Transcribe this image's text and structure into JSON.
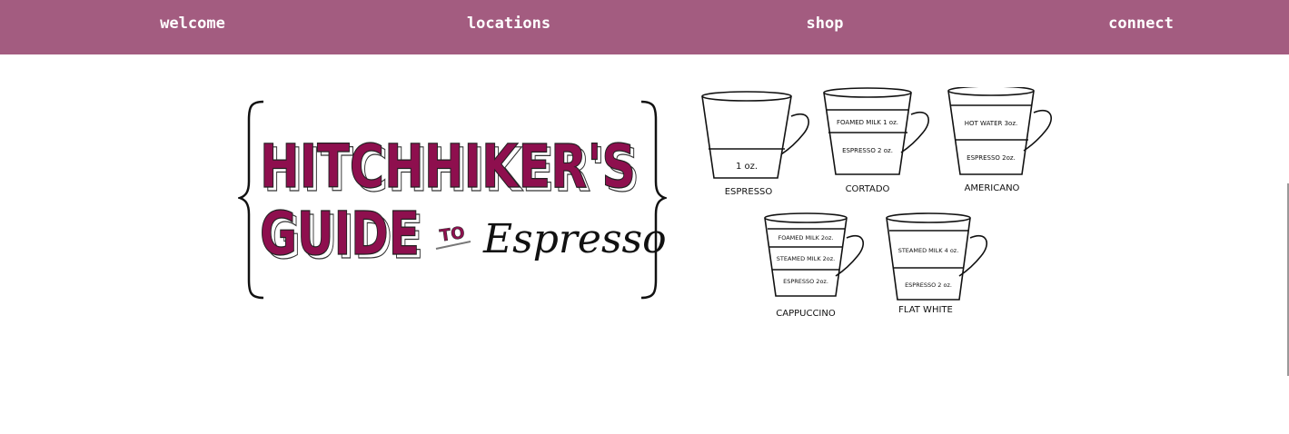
{
  "nav": {
    "items": [
      "welcome",
      "locations",
      "shop",
      "connect"
    ],
    "background": "#a35c80",
    "text_color": "#ffffff"
  },
  "logo": {
    "line1": "HITCHHIKER'S",
    "line2": "GUIDE",
    "to": "TO",
    "script": "Espresso",
    "fill_color": "#8e0f4e"
  },
  "cups": [
    {
      "name": "ESPRESSO",
      "layers": [
        "1 oz."
      ]
    },
    {
      "name": "CORTADO",
      "layers": [
        "FOAMED MILK 1 oz.",
        "ESPRESSO 2 oz."
      ]
    },
    {
      "name": "AMERICANO",
      "layers": [
        "HOT WATER 3oz.",
        "ESPRESSO 2oz."
      ]
    },
    {
      "name": "CAPPUCCINO",
      "layers": [
        "FOAMED MILK 2oz.",
        "STEAMED MILK 2oz.",
        "ESPRESSO 2oz."
      ]
    },
    {
      "name": "FLAT WHITE",
      "layers": [
        "STEAMED MILK 4 oz.",
        "ESPRESSO 2 oz."
      ]
    }
  ]
}
